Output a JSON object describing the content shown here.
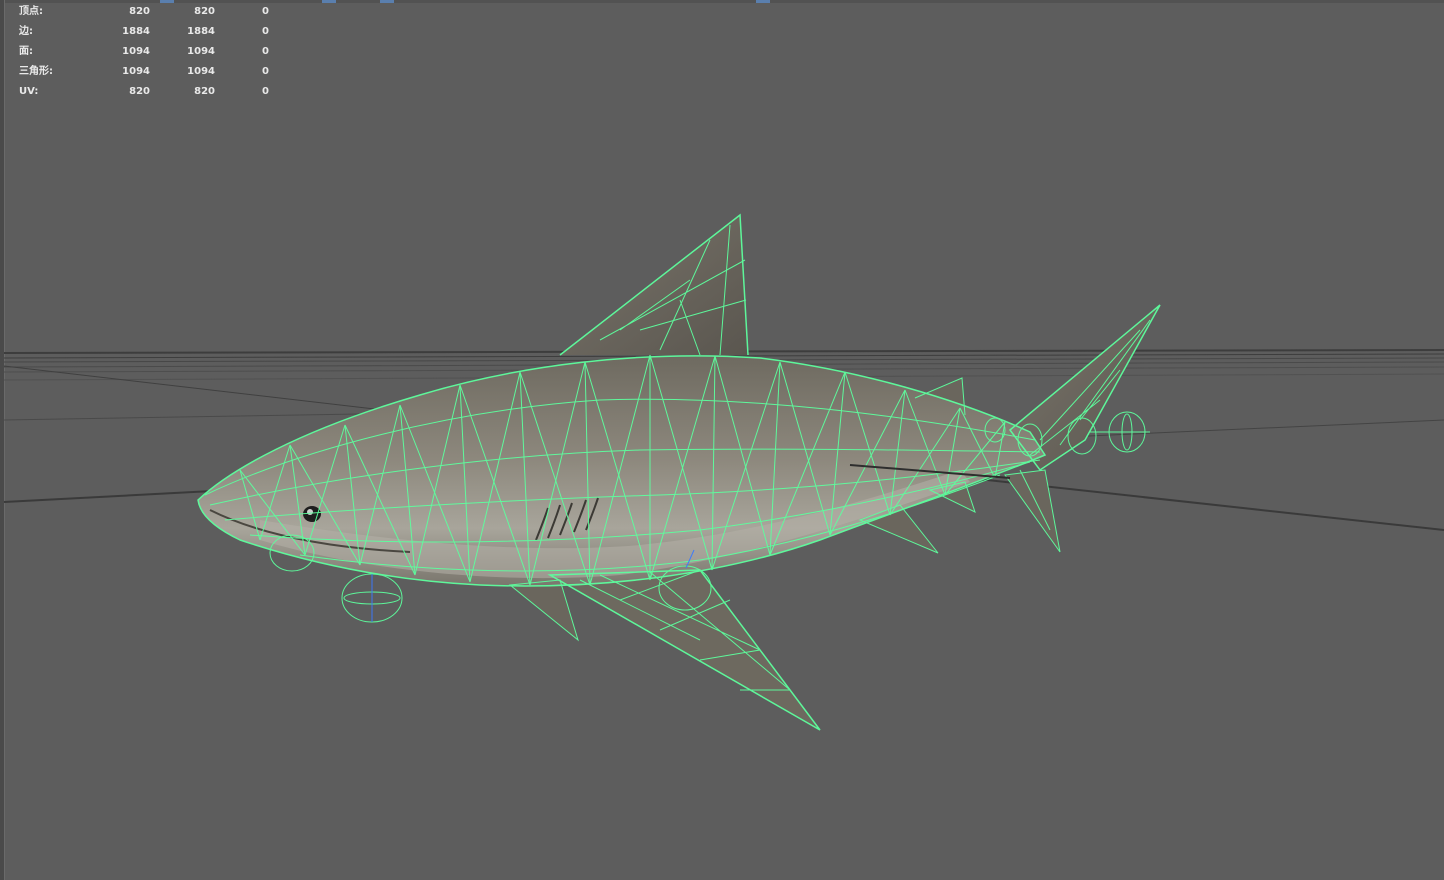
{
  "heads_up_display": {
    "rows": [
      {
        "label": "顶点:",
        "c1": "820",
        "c2": "820",
        "c3": "0"
      },
      {
        "label": "边:",
        "c1": "1884",
        "c2": "1884",
        "c3": "0"
      },
      {
        "label": "面:",
        "c1": "1094",
        "c2": "1094",
        "c3": "0"
      },
      {
        "label": "三角形:",
        "c1": "1094",
        "c2": "1094",
        "c3": "0"
      },
      {
        "label": "UV:",
        "c1": "820",
        "c2": "820",
        "c3": "0"
      }
    ]
  },
  "colors": {
    "viewport_bg": "#5d5d5d",
    "wireframe": "#5dff9e",
    "shark_body": "#8a857b",
    "grid": "#3f3f3f"
  },
  "viewport": {
    "object": "shark-model",
    "display_mode": "wireframe-on-shaded"
  }
}
